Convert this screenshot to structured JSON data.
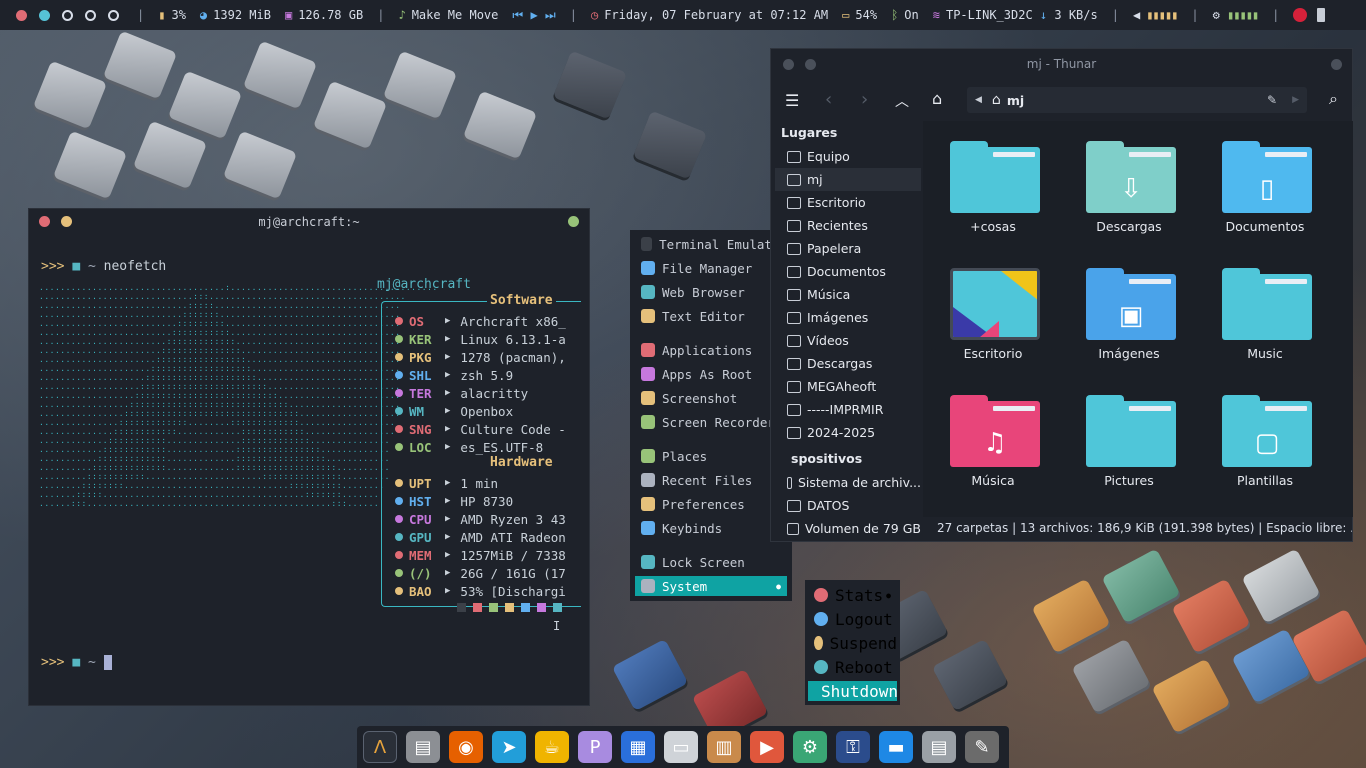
{
  "topbar": {
    "cpu": "3%",
    "memory": "1392 MiB",
    "disk": "126.78 GB",
    "music": "Make Me Move",
    "datetime": "Friday, 07 February at 07:12 AM",
    "battery": "54%",
    "bluetooth": "On",
    "network": "TP-LINK_3D2C",
    "net_speed": "3 KB/s",
    "workspace_colors": [
      "#e06c75",
      "#56c2d6"
    ]
  },
  "terminal": {
    "title": "mj@archcraft:~",
    "prompt_symbol": ">>>",
    "dir": "~",
    "command": "neofetch",
    "user_host": "mj@archcraft",
    "software_label": "Software",
    "hardware_label": "Hardware",
    "software": [
      {
        "key": "OS",
        "value": "Archcraft x86_",
        "color": "#e06c75"
      },
      {
        "key": "KER",
        "value": "Linux 6.13.1-a",
        "color": "#98c379"
      },
      {
        "key": "PKG",
        "value": "1278 (pacman),",
        "color": "#e5c07b"
      },
      {
        "key": "SHL",
        "value": "zsh 5.9",
        "color": "#61afef"
      },
      {
        "key": "TER",
        "value": "alacritty",
        "color": "#c678dd"
      },
      {
        "key": "WM",
        "value": "Openbox",
        "color": "#56b6c2"
      },
      {
        "key": "SNG",
        "value": "Culture Code -",
        "color": "#e06c75"
      },
      {
        "key": "LOC",
        "value": "es_ES.UTF-8",
        "color": "#98c379"
      }
    ],
    "hardware": [
      {
        "key": "UPT",
        "value": "1 min",
        "color": "#e5c07b"
      },
      {
        "key": "HST",
        "value": "HP 8730",
        "color": "#61afef"
      },
      {
        "key": "CPU",
        "value": "AMD Ryzen 3 43",
        "color": "#c678dd"
      },
      {
        "key": "GPU",
        "value": "AMD ATI Radeon",
        "color": "#56b6c2"
      },
      {
        "key": "MEM",
        "value": "1257MiB / 7338",
        "color": "#e06c75"
      },
      {
        "key": "(/)",
        "value": "26G / 161G (17",
        "color": "#98c379"
      },
      {
        "key": "BAO",
        "value": "53% [Dischargi",
        "color": "#e5c07b"
      }
    ],
    "palette": [
      "#3b4048",
      "#e06c75",
      "#98c379",
      "#e5c07b",
      "#61afef",
      "#c678dd",
      "#56b6c2"
    ]
  },
  "menu": {
    "items": [
      {
        "label": "Terminal Emulator",
        "icon": "terminal-icon"
      },
      {
        "label": "File Manager",
        "icon": "folder-icon"
      },
      {
        "label": "Web Browser",
        "icon": "globe-icon"
      },
      {
        "label": "Text Editor",
        "icon": "edit-icon"
      },
      {
        "label": "Applications",
        "icon": "apps-icon"
      },
      {
        "label": "Apps As Root",
        "icon": "root-icon"
      },
      {
        "label": "Screenshot",
        "icon": "camera-icon"
      },
      {
        "label": "Screen Recorder",
        "icon": "video-icon"
      },
      {
        "label": "Places",
        "icon": "places-icon"
      },
      {
        "label": "Recent Files",
        "icon": "recent-icon"
      },
      {
        "label": "Preferences",
        "icon": "gear-icon"
      },
      {
        "label": "Keybinds",
        "icon": "keyboard-icon"
      },
      {
        "label": "Lock Screen",
        "icon": "lock-icon"
      },
      {
        "label": "System",
        "icon": "power-icon"
      }
    ],
    "submenu": [
      {
        "label": "Stats"
      },
      {
        "label": "Logout"
      },
      {
        "label": "Suspend"
      },
      {
        "label": "Reboot"
      },
      {
        "label": "Shutdown"
      }
    ]
  },
  "thunar": {
    "title": "mj - Thunar",
    "path": "mj",
    "places_header": "Lugares",
    "devices_header": "spositivos",
    "places": [
      "Equipo",
      "mj",
      "Escritorio",
      "Recientes",
      "Papelera",
      "Documentos",
      "Música",
      "Imágenes",
      "Vídeos",
      "Descargas",
      "MEGAheoft",
      "-----IMPRMIR",
      "2024-2025"
    ],
    "devices": [
      "Sistema de archiv...",
      "DATOS",
      "Volumen de 79 GB"
    ],
    "folders": [
      {
        "name": "+cosas",
        "color": "#4fc6d9"
      },
      {
        "name": "Descargas",
        "color": "#7fcfc9"
      },
      {
        "name": "Documentos",
        "color": "#4fb9ef"
      },
      {
        "name": "Escritorio",
        "color": "#2a2f38"
      },
      {
        "name": "Imágenes",
        "color": "#4aa3ea"
      },
      {
        "name": "Music",
        "color": "#4fc6d9"
      },
      {
        "name": "Música",
        "color": "#e8457a"
      },
      {
        "name": "Pictures",
        "color": "#4fc6d9"
      },
      {
        "name": "Plantillas",
        "color": "#4fc6d9"
      }
    ],
    "status": "27 carpetas  |  13 archivos: 186,9 KiB (191.398 bytes)  |  Espacio libre: ..."
  },
  "dock": {
    "apps": [
      "archcraft-icon",
      "files-icon",
      "firefox-icon",
      "telegram-icon",
      "kettle-icon",
      "pdf-icon",
      "writer-icon",
      "image-viewer-icon",
      "archive-icon",
      "slides-icon",
      "android-icon",
      "keepass-icon",
      "folder-icon",
      "files-alt-icon",
      "gimp-icon"
    ]
  }
}
